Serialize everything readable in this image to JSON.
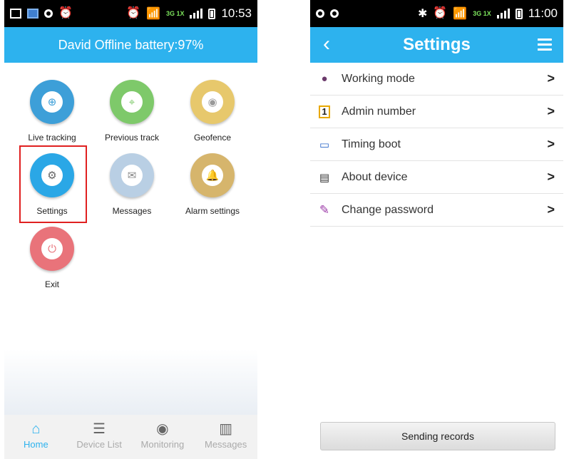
{
  "left": {
    "status": {
      "time": "10:53",
      "net": "3G 1X"
    },
    "title": "David Offline battery:97%",
    "tiles": [
      {
        "label": "Live tracking",
        "icon": "crosshair-icon",
        "color": "#3d9fd8"
      },
      {
        "label": "Previous track",
        "icon": "map-pin-icon",
        "color": "#7ec96a"
      },
      {
        "label": "Geofence",
        "icon": "target-icon",
        "color": "#e7c86c"
      },
      {
        "label": "Settings",
        "icon": "gear-icon",
        "color": "#2aa7e6"
      },
      {
        "label": "Messages",
        "icon": "envelope-icon",
        "color": "#b9cfe4"
      },
      {
        "label": "Alarm settings",
        "icon": "bell-icon",
        "color": "#d6b56c"
      },
      {
        "label": "Exit",
        "icon": "exit-icon",
        "color": "#e9737a"
      }
    ],
    "nav": [
      {
        "label": "Home",
        "icon": "home-icon",
        "active": true
      },
      {
        "label": "Device List",
        "icon": "list-icon",
        "active": false
      },
      {
        "label": "Monitoring",
        "icon": "eye-icon",
        "active": false
      },
      {
        "label": "Messages",
        "icon": "map-icon",
        "active": false
      }
    ]
  },
  "right": {
    "status": {
      "time": "11:00",
      "net": "3G 1X"
    },
    "title": "Settings",
    "items": [
      {
        "label": "Working mode",
        "icon": "mouse-icon",
        "color": "#6b3a6b"
      },
      {
        "label": "Admin number",
        "icon": "number-one-icon",
        "color": "#e8a800"
      },
      {
        "label": "Timing boot",
        "icon": "laptop-clock-icon",
        "color": "#2b67c8"
      },
      {
        "label": "About device",
        "icon": "document-icon",
        "color": "#333333"
      },
      {
        "label": "Change password",
        "icon": "edit-icon",
        "color": "#9c3aa8"
      }
    ],
    "button": "Sending records",
    "arrow": ">"
  },
  "accent": "#2db2ee"
}
